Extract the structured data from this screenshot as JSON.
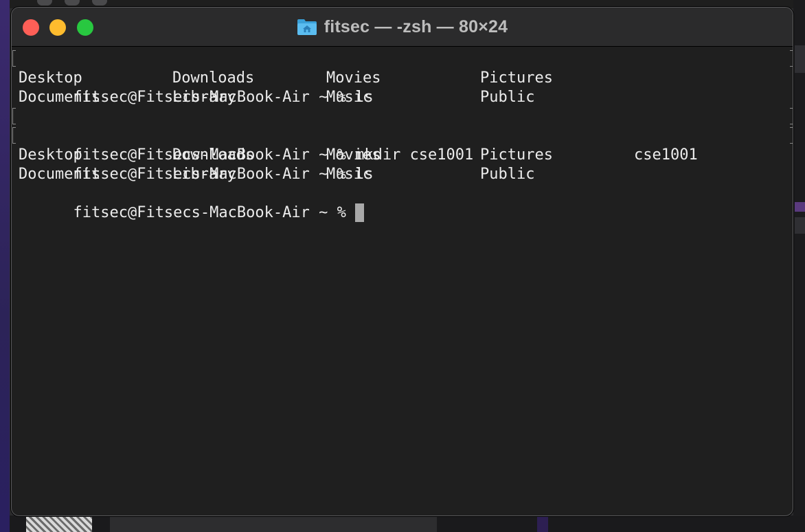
{
  "window": {
    "title": "fitsec — -zsh — 80×24",
    "title_icon": "home-folder-icon"
  },
  "colors": {
    "close": "#fe5f57",
    "minimize": "#febc2e",
    "maximize": "#28c840",
    "terminal_bg": "#1f1f1f",
    "terminal_fg": "#ececec"
  },
  "terminal": {
    "prompt": "fitsec@Fitsecs-MacBook-Air ~ % ",
    "commands": [
      "ls",
      "mkdir cse1001",
      "ls"
    ],
    "ls1": {
      "row1": [
        "Desktop",
        "Downloads",
        "Movies",
        "Pictures"
      ],
      "row2": [
        "Documents",
        "Library",
        "Music",
        "Public"
      ]
    },
    "ls2": {
      "row1": [
        "Desktop",
        "Downloads",
        "Movies",
        "Pictures",
        "cse1001"
      ],
      "row2": [
        "Documents",
        "Library",
        "Music",
        "Public"
      ]
    }
  }
}
